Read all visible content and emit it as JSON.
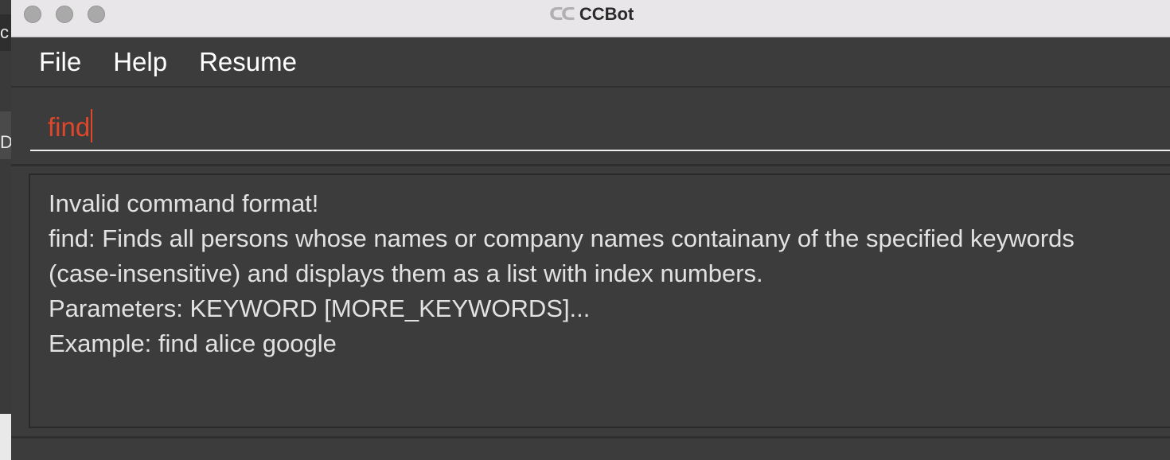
{
  "background_window": {
    "fragment_1": "c",
    "fragment_2": "D"
  },
  "titlebar": {
    "icon": "cc-logo-icon",
    "title": "CCBot"
  },
  "menu": {
    "items": [
      "File",
      "Help",
      "Resume"
    ]
  },
  "command_box": {
    "value": "find",
    "text_color": "#e0462a"
  },
  "result": {
    "lines": [
      "Invalid command format!",
      "find: Finds all persons whose names or company names containany of the specified keywords",
      "(case-insensitive) and displays them as a list with index numbers.",
      "Parameters: KEYWORD [MORE_KEYWORDS]...",
      "Example: find alice google"
    ]
  },
  "colors": {
    "window_bg": "#3c3c3c",
    "titlebar_bg": "#e8e6e8",
    "error_red": "#e0462a"
  }
}
